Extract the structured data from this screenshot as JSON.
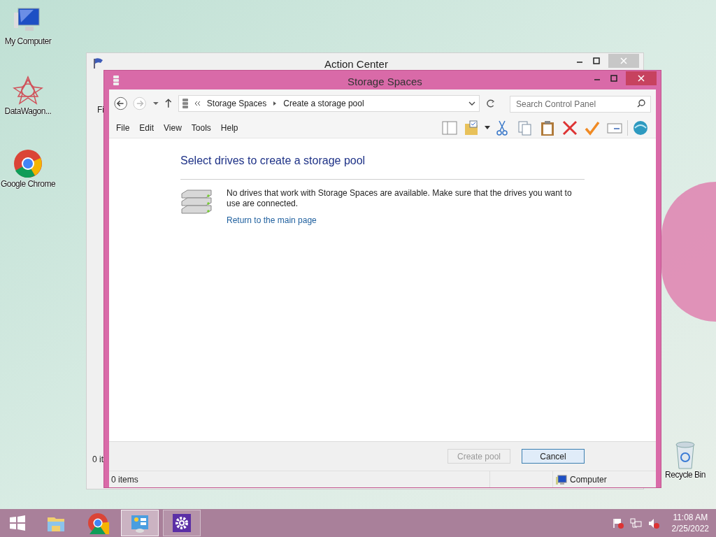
{
  "desktop_icons": [
    {
      "kind": "computer",
      "label": "My Computer"
    },
    {
      "kind": "datawagon",
      "label": "DataWagon..."
    },
    {
      "kind": "chrome",
      "label": "Google Chrome"
    },
    {
      "kind": "recycle",
      "label": "Recycle Bin"
    }
  ],
  "background_window": {
    "title": "Action Center",
    "menu_fragment": "Fi",
    "status_fragment": "0 it"
  },
  "window": {
    "title": "Storage Spaces",
    "address": {
      "breadcrumb": [
        "Storage Spaces",
        "Create a storage pool"
      ]
    },
    "search": {
      "placeholder": "Search Control Panel"
    },
    "menu": [
      "File",
      "Edit",
      "View",
      "Tools",
      "Help"
    ],
    "heading": "Select drives to create a storage pool",
    "message": "No drives that work with Storage Spaces are available. Make sure that the drives you want to use are connected.",
    "link": "Return to the main page",
    "buttons": [
      {
        "label": "Create pool",
        "disabled": true
      },
      {
        "label": "Cancel",
        "disabled": false
      }
    ],
    "status_bar": {
      "items": "0 items",
      "zone": "Computer"
    }
  },
  "taskbar": {
    "apps": [
      {
        "kind": "explorer",
        "selected": false
      },
      {
        "kind": "chrome",
        "selected": false
      },
      {
        "kind": "control-panel",
        "selected": true
      },
      {
        "kind": "settings",
        "selected": false
      }
    ],
    "clock": {
      "time": "11:08 AM",
      "date": "2/25/2022"
    }
  }
}
